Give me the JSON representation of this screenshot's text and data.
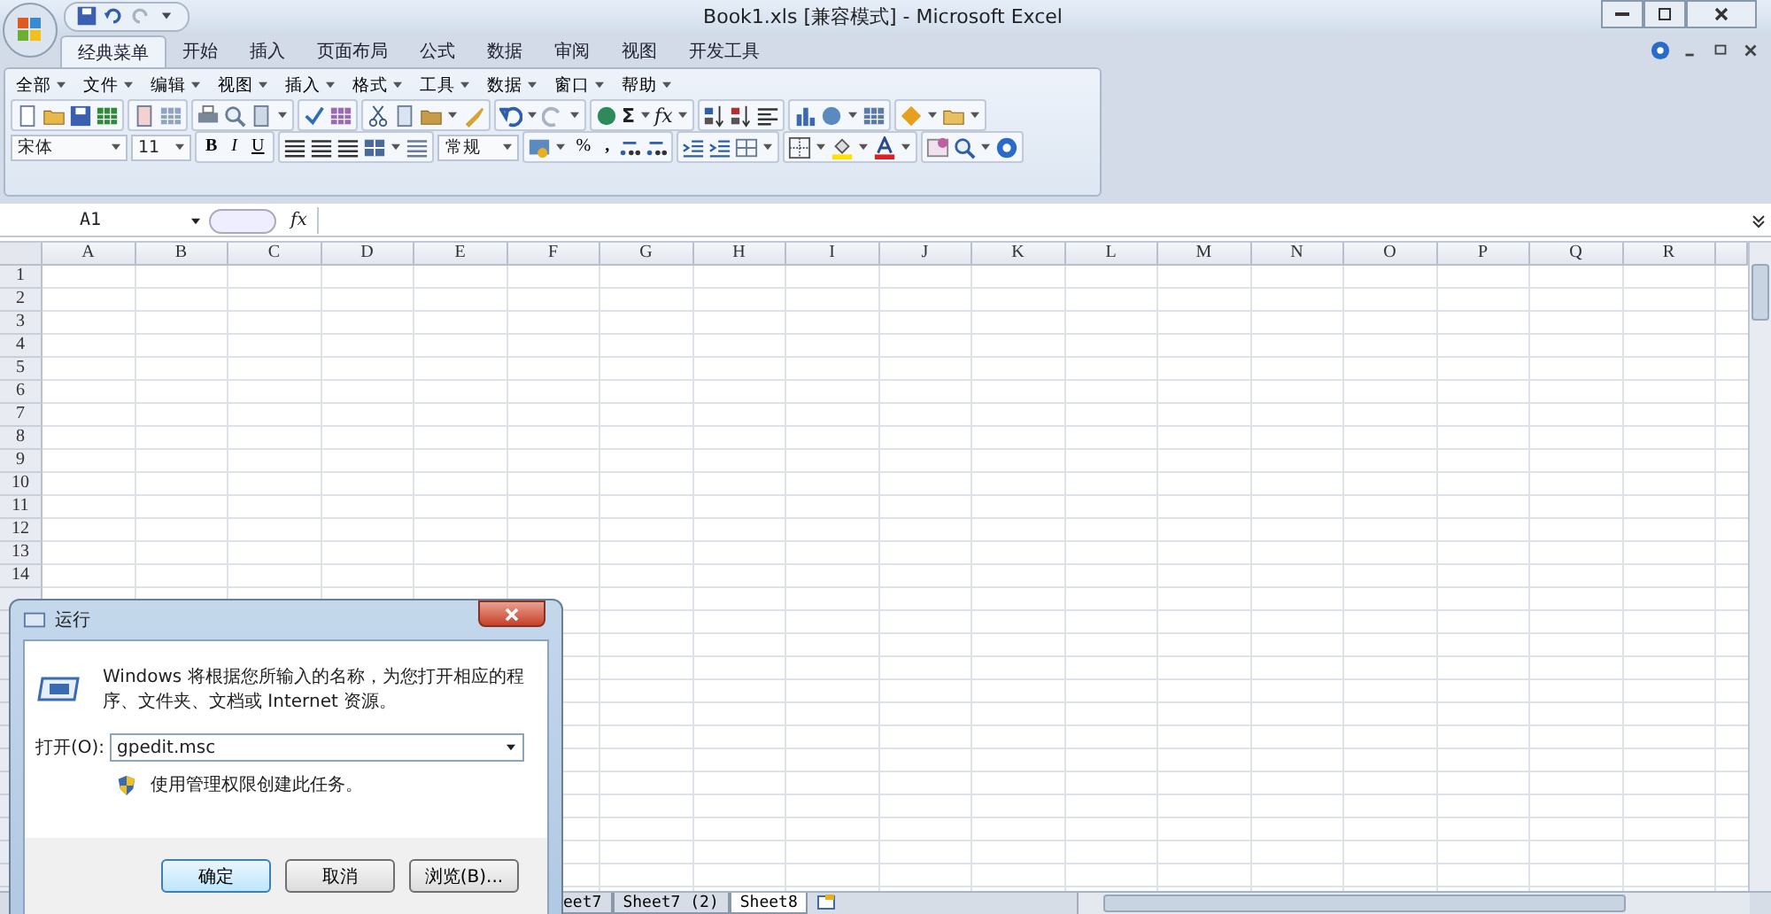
{
  "window": {
    "title": "Book1.xls  [兼容模式] - Microsoft Excel"
  },
  "ribbon_tabs": [
    {
      "label": "经典菜单",
      "selected": true
    },
    {
      "label": "开始",
      "selected": false
    },
    {
      "label": "插入",
      "selected": false
    },
    {
      "label": "页面布局",
      "selected": false
    },
    {
      "label": "公式",
      "selected": false
    },
    {
      "label": "数据",
      "selected": false
    },
    {
      "label": "审阅",
      "selected": false
    },
    {
      "label": "视图",
      "selected": false
    },
    {
      "label": "开发工具",
      "selected": false
    }
  ],
  "classic_menus": [
    "全部",
    "文件",
    "编辑",
    "视图",
    "插入",
    "格式",
    "工具",
    "数据",
    "窗口",
    "帮助"
  ],
  "toolbar": {
    "sum_label": "Σ",
    "function_label": "fx",
    "font": "宋体",
    "font_size": "11",
    "style_buttons": [
      "B",
      "I",
      "U"
    ],
    "number_format": "常规",
    "percent_label": "%",
    "comma_label": ","
  },
  "formula_bar": {
    "name_box": "A1",
    "function_label": "fx"
  },
  "columns": [
    "A",
    "B",
    "C",
    "D",
    "E",
    "F",
    "G",
    "H",
    "I",
    "J",
    "K",
    "L",
    "M",
    "N",
    "O",
    "P",
    "Q",
    "R"
  ],
  "rows": [
    "1",
    "2",
    "3",
    "4",
    "5",
    "6",
    "7",
    "8",
    "9",
    "10",
    "11",
    "12",
    "13",
    "14"
  ],
  "sheet_tabs": [
    {
      "label": "eet7",
      "selected": false
    },
    {
      "label": "Sheet7 (2)",
      "selected": false
    },
    {
      "label": "Sheet8",
      "selected": true
    }
  ],
  "run_dialog": {
    "title": "运行",
    "message": "Windows 将根据您所输入的名称，为您打开相应的程序、文件夹、文档或 Internet 资源。",
    "open_label": "打开(O):",
    "value": "gpedit.msc",
    "admin_note": "使用管理权限创建此任务。",
    "buttons": [
      {
        "label": "确定",
        "default": true
      },
      {
        "label": "取消",
        "default": false
      },
      {
        "label": "浏览(B)...",
        "default": false
      }
    ]
  }
}
